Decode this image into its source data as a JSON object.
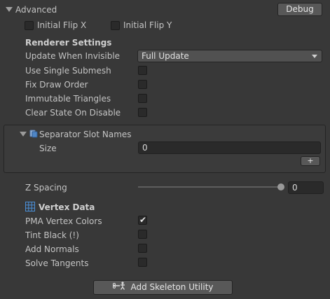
{
  "header": {
    "title": "Advanced",
    "debug_label": "Debug"
  },
  "flip": {
    "x_label": "Initial Flip X",
    "y_label": "Initial Flip Y"
  },
  "renderer": {
    "heading": "Renderer Settings",
    "update_label": "Update When Invisible",
    "update_value": "Full Update",
    "single_submesh": "Use Single Submesh",
    "fix_draw_order": "Fix Draw Order",
    "immutable_triangles": "Immutable Triangles",
    "clear_state": "Clear State On Disable"
  },
  "separator": {
    "title": "Separator Slot Names",
    "size_label": "Size",
    "size_value": "0",
    "add_label": "+"
  },
  "zspacing": {
    "label": "Z Spacing",
    "value": "0",
    "slider_fraction": 0
  },
  "vertex": {
    "heading": "Vertex Data",
    "pma_label": "PMA Vertex Colors",
    "pma_checked": true,
    "tint_black": "Tint Black (!)",
    "add_normals": "Add Normals",
    "solve_tangents": "Solve Tangents"
  },
  "footer": {
    "add_utility_label": "Add Skeleton Utility"
  }
}
